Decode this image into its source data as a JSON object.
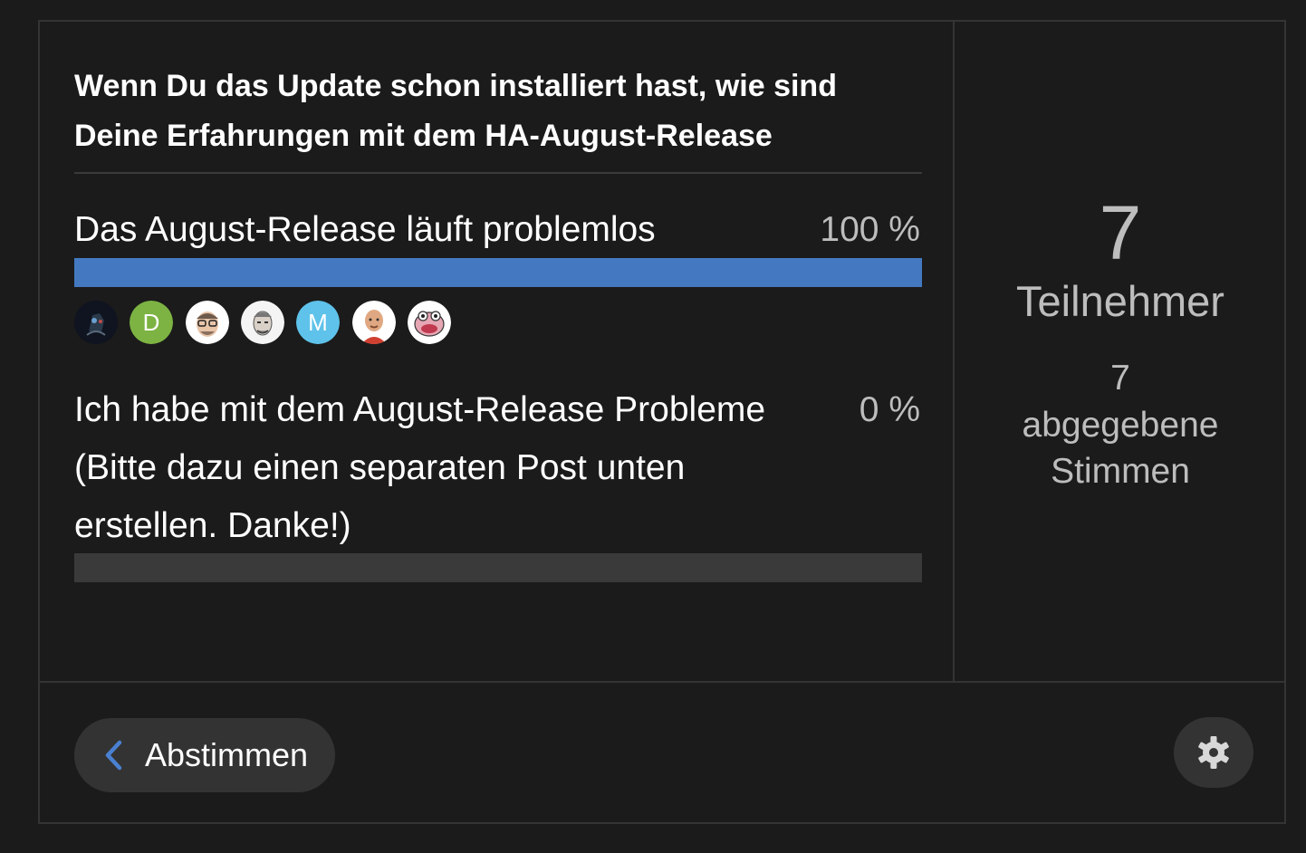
{
  "poll": {
    "title": "Wenn Du das Update schon installiert hast, wie sind Deine Erfahrungen mit dem HA-August-Release",
    "options": [
      {
        "label": "Das August-Release läuft problemlos",
        "percent_label": "100 %",
        "fill_fraction": 1.0,
        "voters": [
          "avatar-dark",
          "D",
          "avatar-glasses",
          "avatar-sketch",
          "M",
          "avatar-bald",
          "avatar-hippo"
        ]
      },
      {
        "label": "Ich habe mit dem August-Release Probleme (Bitte dazu einen separaten Post unten erstellen. Danke!)",
        "percent_label": "0 %",
        "fill_fraction": 0.0
      }
    ],
    "participants_count": "7",
    "participants_label": "Teilnehmer",
    "votes_count": "7",
    "votes_label": "abgegebene Stimmen"
  },
  "footer": {
    "vote_button_label": "Abstimmen",
    "vote_button_icon": "chevron-left-icon",
    "settings_icon": "gear-icon"
  },
  "colors": {
    "background": "#1b1b1b",
    "border": "#343434",
    "bar_fill": "#4479c1",
    "bar_track": "#3a3a3a",
    "muted_text": "#bdbdbd",
    "avatar_d": "#7cb342",
    "avatar_m": "#5ec2ea"
  }
}
